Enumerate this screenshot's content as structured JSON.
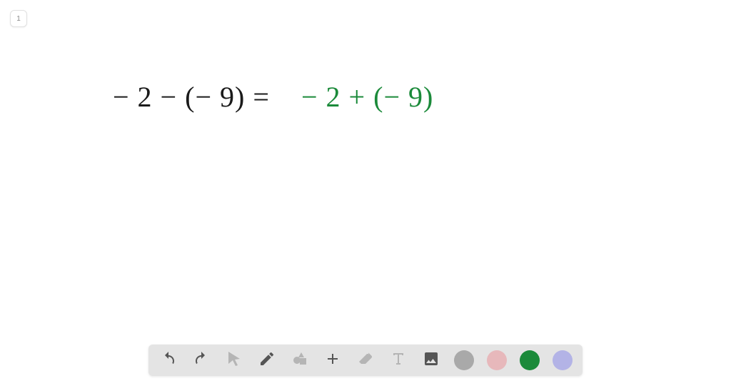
{
  "page": {
    "number": "1"
  },
  "equation": {
    "left": "− 2 − (− 9)  =",
    "right": "− 2 + (− 9)"
  },
  "toolbar": {
    "tools": [
      {
        "name": "undo-icon"
      },
      {
        "name": "redo-icon"
      },
      {
        "name": "pointer-icon"
      },
      {
        "name": "pencil-icon"
      },
      {
        "name": "shapes-icon"
      },
      {
        "name": "plus-icon"
      },
      {
        "name": "eraser-icon"
      },
      {
        "name": "text-icon"
      },
      {
        "name": "image-icon"
      }
    ],
    "colors": {
      "gray": "#a9a9a9",
      "pink": "#e7b8bb",
      "green": "#1b8a3a",
      "lavender": "#b3b3e6"
    }
  }
}
